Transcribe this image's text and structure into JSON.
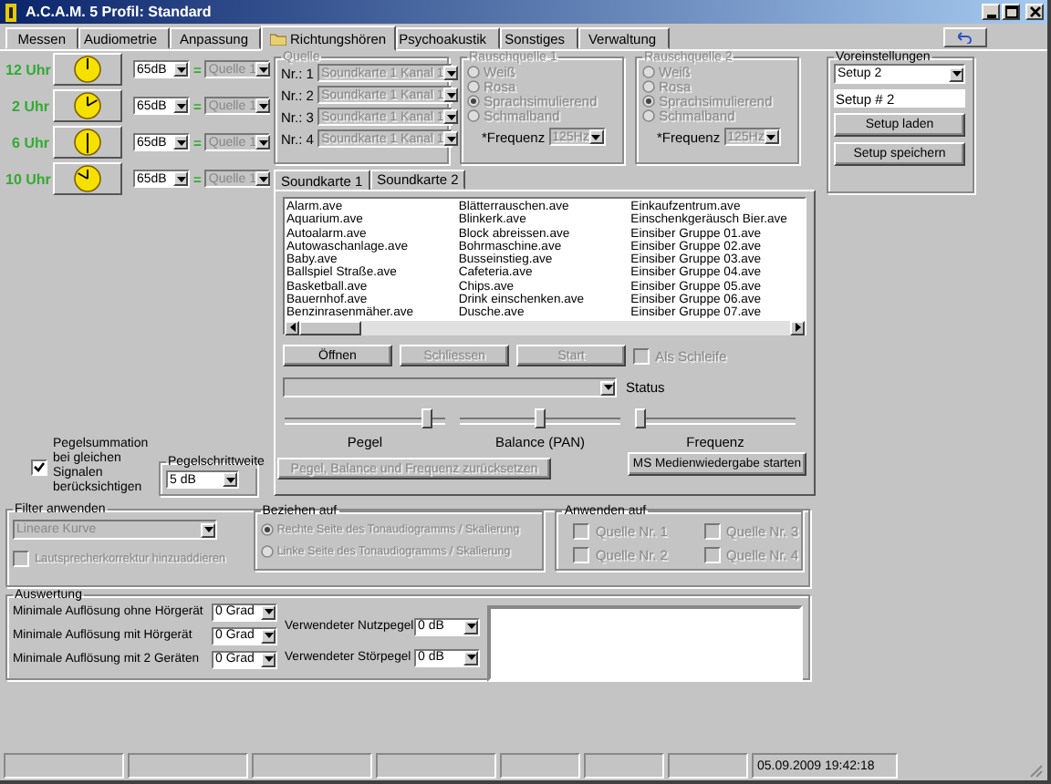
{
  "window": {
    "title": "A.C.A.M. 5 Profil: Standard"
  },
  "tabs": [
    {
      "label": "Messen",
      "selected": false
    },
    {
      "label": "Audiometrie",
      "selected": false
    },
    {
      "label": "Anpassung",
      "selected": false
    },
    {
      "label": "Richtungshören",
      "selected": true
    },
    {
      "label": "Psychoakustik",
      "selected": false
    },
    {
      "label": "Sonstiges",
      "selected": false
    },
    {
      "label": "Verwaltung",
      "selected": false
    }
  ],
  "directions": [
    {
      "label": "12 Uhr",
      "level": "65dB",
      "operator": "=",
      "source": "Quelle 1",
      "disabled": true
    },
    {
      "label": "2 Uhr",
      "level": "65dB",
      "operator": "=",
      "source": "Quelle 1",
      "disabled": true
    },
    {
      "label": "6 Uhr",
      "level": "65dB",
      "operator": "=",
      "source": "Quelle 1",
      "disabled": true
    },
    {
      "label": "10 Uhr",
      "level": "65dB",
      "operator": "=",
      "source": "Quelle 1",
      "disabled": true
    }
  ],
  "sources": {
    "title": "Quelle",
    "disabled": true,
    "rows": [
      {
        "label": "Nr.: 1",
        "value": "Soundkarte 1 Kanal 1"
      },
      {
        "label": "Nr.: 2",
        "value": "Soundkarte 1 Kanal 1"
      },
      {
        "label": "Nr.: 3",
        "value": "Soundkarte 1 Kanal 1"
      },
      {
        "label": "Nr.: 4",
        "value": "Soundkarte 1 Kanal 1"
      }
    ]
  },
  "noise_sources": [
    {
      "title": "Rauschquelle 1",
      "disabled": true,
      "options": [
        {
          "label": "Weiß",
          "selected": false
        },
        {
          "label": "Rosa",
          "selected": false
        },
        {
          "label": "Sprachsimulierend",
          "selected": true
        },
        {
          "label": "Schmalband",
          "selected": false
        }
      ],
      "frequency_label": "*Frequenz",
      "frequency": "125Hz"
    },
    {
      "title": "Rauschquelle 2",
      "disabled": true,
      "options": [
        {
          "label": "Weiß",
          "selected": false
        },
        {
          "label": "Rosa",
          "selected": false
        },
        {
          "label": "Sprachsimulierend",
          "selected": true
        },
        {
          "label": "Schmalband",
          "selected": false
        }
      ],
      "frequency_label": "*Frequenz",
      "frequency": "125Hz"
    }
  ],
  "presets": {
    "title": "Voreinstellungen",
    "selected": "Setup 2",
    "name": "Setup # 2",
    "buttons": [
      "Setup laden",
      "Setup speichern"
    ]
  },
  "sound": {
    "tabs": [
      {
        "label": "Soundkarte 1",
        "selected": true
      },
      {
        "label": "Soundkarte 2",
        "selected": false
      }
    ],
    "files": [
      [
        "Alarm.ave",
        "Aquarium.ave",
        "Autoalarm.ave",
        "Autowaschanlage.ave",
        "Baby.ave",
        "Ballspiel Straße.ave",
        "Basketball.ave",
        "Bauernhof.ave",
        "Benzinrasenmäher.ave"
      ],
      [
        "Blätterrauschen.ave",
        "Blinkerk.ave",
        "Block abreissen.ave",
        "Bohrmaschine.ave",
        "Busseinstieg.ave",
        "Cafeteria.ave",
        "Chips.ave",
        "Drink einschenken.ave",
        "Dusche.ave"
      ],
      [
        "Einkaufzentrum.ave",
        "Einschenkgeräusch Bier.ave",
        "Einsiber Gruppe 01.ave",
        "Einsiber Gruppe 02.ave",
        "Einsiber Gruppe 03.ave",
        "Einsiber Gruppe 04.ave",
        "Einsiber Gruppe 05.ave",
        "Einsiber Gruppe 06.ave",
        "Einsiber Gruppe 07.ave"
      ]
    ],
    "buttons": [
      {
        "label": "Öffnen",
        "disabled": false
      },
      {
        "label": "Schliessen",
        "disabled": true
      },
      {
        "label": "Start",
        "disabled": true
      }
    ],
    "loop": {
      "label": "Als Schleife",
      "checked": false,
      "disabled": true
    },
    "device_disabled": true,
    "status_label": "Status",
    "sliders": [
      {
        "label": "Pegel",
        "level": 0.92
      },
      {
        "label": "Balance (PAN)",
        "level": 0.5
      },
      {
        "label": "Frequenz",
        "level": 0.0
      }
    ],
    "reset_button": {
      "label": "Pegel, Balance und Frequenz zurücksetzen",
      "disabled": true
    },
    "media_button": "MS Medienwiedergabe starten"
  },
  "summation": {
    "label": "Pegelsummation bei gleichen Signalen berücksichtigen",
    "checked": true
  },
  "step": {
    "title": "Pegelschrittweite",
    "value": "5 dB"
  },
  "filter": {
    "title": "Filter anwenden",
    "curve": "Lineare Kurve",
    "disabled": true,
    "correction": {
      "label": "Lautsprecherkorrektur hinzuaddieren",
      "checked": false
    },
    "relate": {
      "title": "Beziehen auf",
      "options": [
        {
          "label": "Rechte Seite des Tonaudiogramms / Skalierung",
          "selected": true
        },
        {
          "label": "Linke Seite des Tonaudiogramms / Skalierung",
          "selected": false
        }
      ]
    },
    "apply": {
      "title": "Anwenden auf",
      "sources": [
        {
          "label": "Quelle Nr. 1",
          "checked": false
        },
        {
          "label": "Quelle Nr. 2",
          "checked": false
        },
        {
          "label": "Quelle Nr. 3",
          "checked": false
        },
        {
          "label": "Quelle Nr. 4",
          "checked": false
        }
      ]
    }
  },
  "evaluation": {
    "title": "Auswertung",
    "resolutions": [
      {
        "label": "Minimale Auflösung ohne Hörgerät",
        "value": "0 Grad"
      },
      {
        "label": "Minimale Auflösung mit Hörgerät",
        "value": "0 Grad"
      },
      {
        "label": "Minimale Auflösung mit 2 Geräten",
        "value": "0 Grad"
      }
    ],
    "levels": [
      {
        "label": "Verwendeter Nutzpegel",
        "value": "0 dB"
      },
      {
        "label": "Verwendeter Störpegel",
        "value": "0 dB"
      }
    ]
  },
  "status_bar": {
    "date_time": "05.09.2009 19:42:18"
  }
}
